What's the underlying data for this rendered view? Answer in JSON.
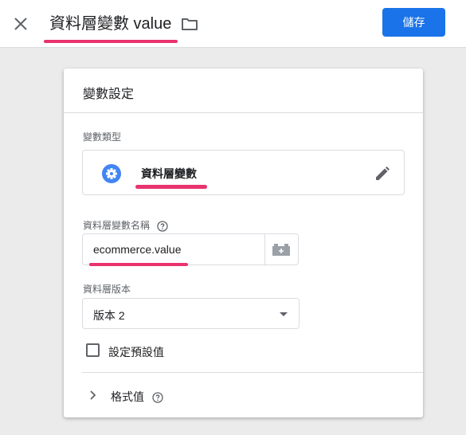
{
  "header": {
    "title": "資料層變數 value",
    "save_label": "儲存",
    "icons": {
      "close": "close-icon",
      "folder": "folder-icon"
    },
    "accent_color": "#1a73e8",
    "highlight_color": "#e8336d"
  },
  "card": {
    "title": "變數設定",
    "variable_type": {
      "label": "變數類型",
      "value": "資料層變數",
      "icon": "gear-icon",
      "edit_icon": "pencil-icon"
    },
    "data_layer_name": {
      "label": "資料層變數名稱",
      "value": "ecommerce.value",
      "help_icon": "help-icon",
      "picker_icon": "variable-picker-icon"
    },
    "data_layer_version": {
      "label": "資料層版本",
      "selected": "版本 2"
    },
    "default_value_checkbox": {
      "label": "設定預設值",
      "checked": false
    },
    "format_value": {
      "label": "格式值",
      "expanded": false
    }
  }
}
